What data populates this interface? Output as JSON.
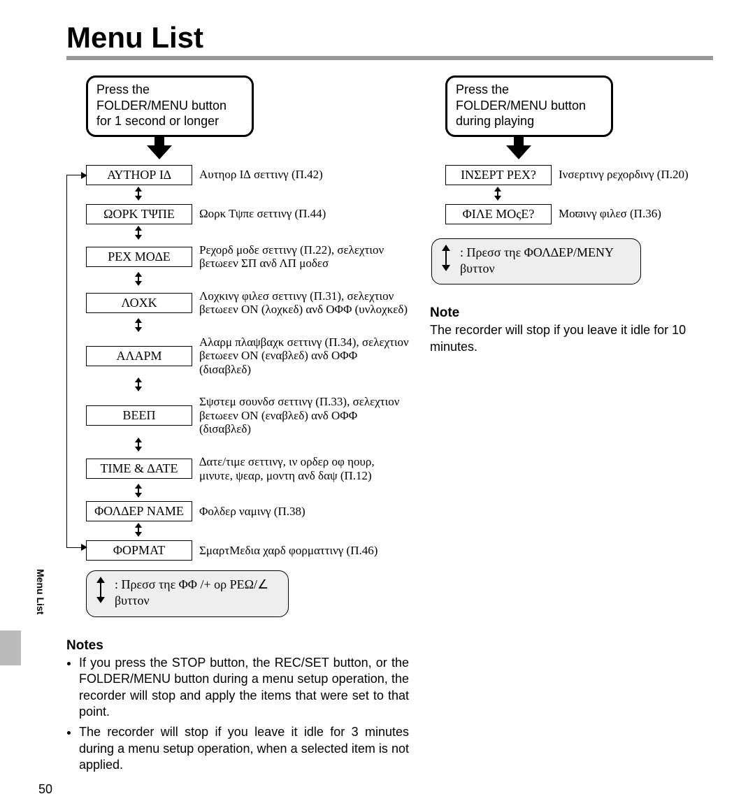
{
  "page_title": "Menu List",
  "side_tab": "Menu List",
  "page_number": "50",
  "left": {
    "instruction": "Press the FOLDER/MENU button for 1 second or longer",
    "items": [
      {
        "label": "ΑΥΤΗΟΡ Ι∆",
        "desc": "Αυτηορ Ι∆ σεττινγ (Π.42)"
      },
      {
        "label": "ΩΟΡΚ ΤΨΠΕ",
        "desc": "Ωορκ Τψπε σεττινγ (Π.44)"
      },
      {
        "label": "ΡΕΧ ΜΟ∆Ε",
        "desc": "Ρεχορδ μοδε σεττινγ (Π.22), σελεχτιον βετωεεν ΣΠ ανδ ΛΠ μοδεσ"
      },
      {
        "label": "ΛΟΧΚ",
        "desc": "Λοχκινγ φιλεσ σεττινγ (Π.31), σελεχτιον βετωεεν ΟΝ (λοχκεδ) ανδ ΟΦΦ (υνλοχκεδ)"
      },
      {
        "label": "ΑΛΑΡΜ",
        "desc": "Αλαρμ πλαψβαχκ σεττινγ (Π.34), σελεχτιον βετωεεν ΟΝ (εναβλεδ) ανδ ΟΦΦ (δισαβλεδ)"
      },
      {
        "label": "ΒΕΕΠ",
        "desc": "Σψστεμ σουνδσ σεττινγ (Π.33), σελεχτιον βετωεεν ΟΝ (εναβλεδ) ανδ ΟΦΦ (δισαβλεδ)"
      },
      {
        "label": "ΤΙΜΕ & ∆ΑΤΕ",
        "desc": "∆ατε/τιμε σεττινγ, ιν ορδερ οφ ηουρ, μινυτε, ψεαρ, μοντη ανδ δαψ (Π.12)"
      },
      {
        "label": "ΦΟΛ∆ΕΡ ΝΑΜΕ",
        "desc": "Φολδερ ναμινγ (Π.38)"
      },
      {
        "label": "ΦΟΡΜΑΤ",
        "desc": "ΣμαρτΜεδια χαρδ φορματτινγ (Π.46)"
      }
    ],
    "hint": ": Πρεσσ τηε ΦΦ /+ ορ ΡΕΩ/∠ βυττον",
    "notes_heading": "Notes",
    "notes": [
      "If you press the STOP button, the REC/SET button, or the FOLDER/MENU button during a menu setup operation, the recorder will stop and apply the items that were set to that point.",
      "The recorder will stop if you leave it idle for 3 minutes during a menu setup operation, when a selected item is not applied."
    ]
  },
  "right": {
    "instruction": "Press the FOLDER/MENU button during playing",
    "items": [
      {
        "label": "ΙΝΣΕΡΤ ΡΕΧ?",
        "desc": "Ινσερτινγ ρεχορδινγ (Π.20)"
      },
      {
        "label": "ΦΙΛΕ ΜΟςΕ?",
        "desc": "Μοϖινγ φιλεσ (Π.36)"
      }
    ],
    "hint": ": Πρεσσ τηε ΦΟΛ∆ΕΡ/ΜΕΝΥ βυττον",
    "note_heading": "Note",
    "note_text": "The recorder will stop if you leave it idle for 10 minutes."
  }
}
